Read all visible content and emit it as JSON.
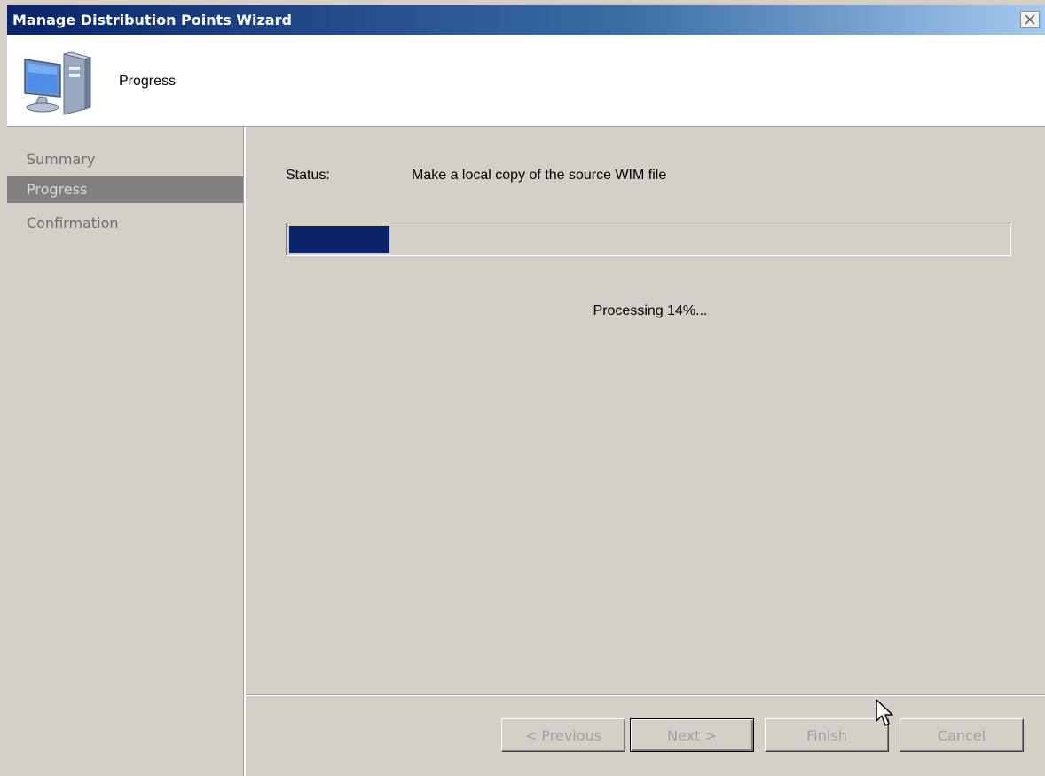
{
  "window": {
    "title": "Manage Distribution Points Wizard",
    "close_icon": "close-icon"
  },
  "header": {
    "title": "Progress",
    "icon": "computer-icon"
  },
  "sidebar": {
    "items": [
      {
        "label": "Summary",
        "selected": false
      },
      {
        "label": "Progress",
        "selected": true
      },
      {
        "label": "Confirmation",
        "selected": false
      }
    ]
  },
  "content": {
    "status_label": "Status:",
    "status_text": "Make a local copy of the source WIM file",
    "progress_percent": 14,
    "processing_text": "Processing 14%..."
  },
  "buttons": {
    "previous": "< Previous",
    "next": "Next >",
    "finish": "Finish",
    "cancel": "Cancel"
  },
  "colors": {
    "title_bar": "#0a246a",
    "progress_fill": "#0a246a",
    "selected_nav": "#808080",
    "background": "#d4d0c8"
  }
}
